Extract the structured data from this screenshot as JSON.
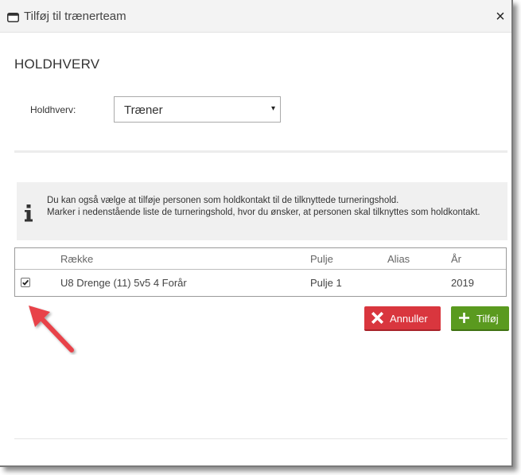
{
  "dialog": {
    "title": "Tilføj til trænerteam",
    "close_label": "×"
  },
  "section": {
    "title": "HOLDHVERV",
    "field_label": "Holdhverv:",
    "select_value": "Træner",
    "select_arrow": "▾"
  },
  "info": {
    "icon": "info-icon",
    "line1": "Du kan også vælge at tilføje personen som holdkontakt til de tilknyttede turneringshold.",
    "line2": "Marker i nedenstående liste de turneringshold, hvor du ønsker, at personen skal tilknyttes som holdkontakt."
  },
  "table": {
    "headers": {
      "raekke": "Række",
      "pulje": "Pulje",
      "alias": "Alias",
      "aar": "År"
    },
    "rows": [
      {
        "checked": true,
        "raekke": "U8 Drenge (11) 5v5 4 Forår",
        "pulje": "Pulje 1",
        "alias": "",
        "aar": "2019"
      }
    ]
  },
  "buttons": {
    "cancel_label": "Annuller",
    "add_label": "Tilføj"
  },
  "colors": {
    "cancel": "#d9363e",
    "add": "#5a9a1f",
    "annotation_arrow": "#e8434a"
  }
}
